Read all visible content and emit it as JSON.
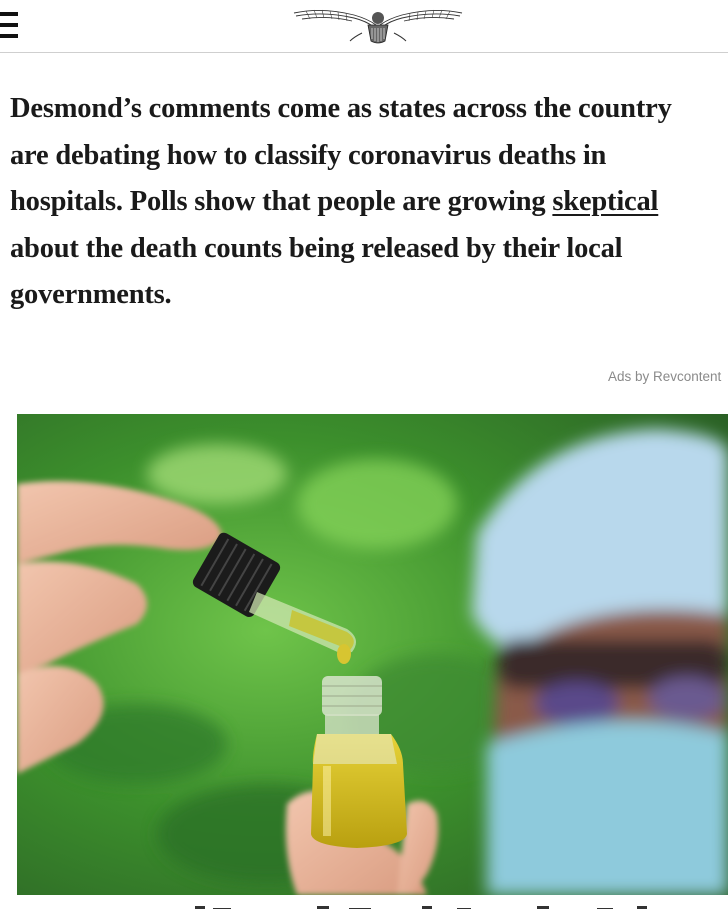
{
  "header": {
    "menu_icon": "hamburger-menu-icon",
    "logo_icon": "eagle-logo-icon"
  },
  "article": {
    "line1": "Desmond’s comments come as states across the country",
    "line2": "are debating how to classify coronavirus deaths in",
    "line3_before": "hospitals. Polls show that people are growing ",
    "line3_link": "skeptical",
    "line4": "about the death counts being released by their local",
    "line5": "governments."
  },
  "ads": {
    "label": "Ads by Revcontent"
  }
}
